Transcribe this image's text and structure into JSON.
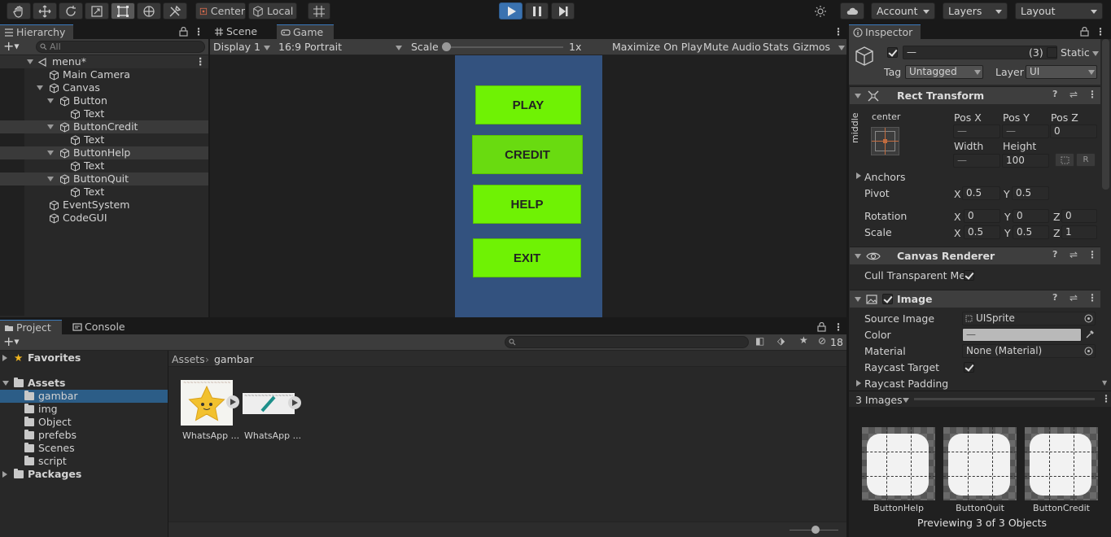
{
  "toolbar": {
    "pivot_mode": "Center",
    "pivot_rotation": "Local",
    "account": "Account",
    "layers": "Layers",
    "layout": "Layout"
  },
  "hierarchy": {
    "tab": "Hierarchy",
    "search_placeholder": "All",
    "scene": "menu*",
    "items": [
      {
        "label": "Main Camera"
      },
      {
        "label": "Canvas"
      },
      {
        "label": "Button"
      },
      {
        "label": "Text"
      },
      {
        "label": "ButtonCredit"
      },
      {
        "label": "Text"
      },
      {
        "label": "ButtonHelp"
      },
      {
        "label": "Text"
      },
      {
        "label": "ButtonQuit"
      },
      {
        "label": "Text"
      },
      {
        "label": "EventSystem"
      },
      {
        "label": "CodeGUI"
      }
    ]
  },
  "views": {
    "scene_tab": "Scene",
    "game_tab": "Game",
    "display": "Display 1",
    "aspect": "16:9 Portrait",
    "scale_label": "Scale",
    "scale_value": "1x",
    "maximize": "Maximize On Play",
    "mute": "Mute Audio",
    "stats": "Stats",
    "gizmos": "Gizmos"
  },
  "game": {
    "buttons": [
      "PLAY",
      "CREDIT",
      "HELP",
      "EXIT"
    ],
    "bg_color": "#33527f",
    "button_color": "#6ff204"
  },
  "inspector": {
    "tab": "Inspector",
    "name_value": "—",
    "count": "(3)",
    "static_label": "Static",
    "tag_label": "Tag",
    "tag_value": "Untagged",
    "layer_label": "Layer",
    "layer_value": "UI",
    "rect": {
      "title": "Rect Transform",
      "anchor_h": "center",
      "anchor_v": "middle",
      "posx_label": "Pos X",
      "posx": "—",
      "posy_label": "Pos Y",
      "posy": "—",
      "posz_label": "Pos Z",
      "posz": "0",
      "width_label": "Width",
      "width": "—",
      "height_label": "Height",
      "height": "100",
      "r_button": "R",
      "anchors": "Anchors",
      "pivot_label": "Pivot",
      "pivot_x": "0.5",
      "pivot_y": "0.5",
      "rotation_label": "Rotation",
      "rot_x": "0",
      "rot_y": "0",
      "rot_z": "0",
      "scale_label": "Scale",
      "scale_x": "0.5",
      "scale_y": "0.5",
      "scale_z": "1",
      "x": "X",
      "y": "Y",
      "z": "Z"
    },
    "canvas_renderer": {
      "title": "Canvas Renderer",
      "cull_label": "Cull Transparent Mes"
    },
    "image": {
      "title": "Image",
      "source_label": "Source Image",
      "source_value": "UISprite",
      "color_label": "Color",
      "color_value": "—",
      "material_label": "Material",
      "material_value": "None (Material)",
      "raycast_label": "Raycast Target",
      "padding_label": "Raycast Padding"
    },
    "preview": {
      "header": "3 Images",
      "items": [
        "ButtonHelp",
        "ButtonQuit",
        "ButtonCredit"
      ],
      "footer": "Previewing 3 of 3 Objects"
    }
  },
  "project": {
    "project_tab": "Project",
    "console_tab": "Console",
    "hidden_count": "18",
    "favorites": "Favorites",
    "assets": "Assets",
    "folders": [
      "gambar",
      "img",
      "Object",
      "prefebs",
      "Scenes",
      "script"
    ],
    "packages": "Packages",
    "breadcrumb_root": "Assets",
    "breadcrumb_current": "gambar",
    "files": [
      "WhatsApp ...",
      "WhatsApp ..."
    ]
  }
}
